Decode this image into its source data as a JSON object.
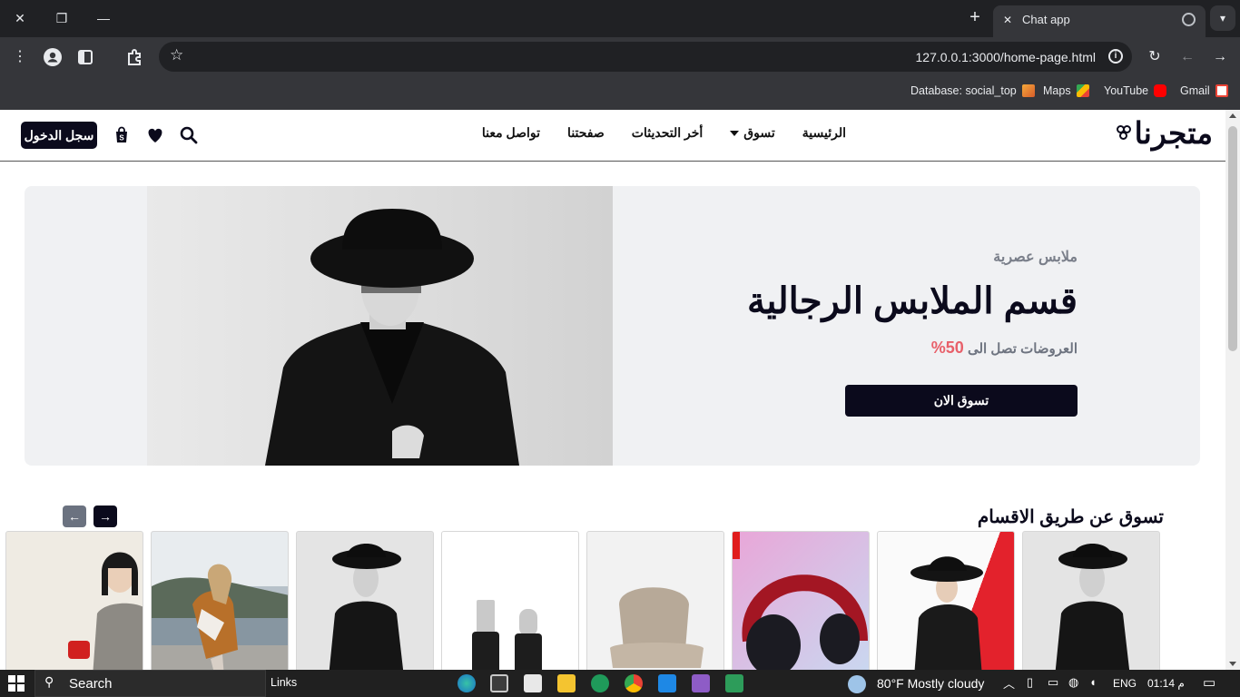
{
  "browser": {
    "tab_title": "Chat app",
    "url": "127.0.0.1:3000/home-page.html",
    "bookmarks": [
      {
        "label": "Database: social_top",
        "icon": "warning-stack-icon"
      },
      {
        "label": "Maps",
        "icon": "maps-icon"
      },
      {
        "label": "YouTube",
        "icon": "youtube-icon"
      },
      {
        "label": "Gmail",
        "icon": "gmail-icon"
      }
    ]
  },
  "site": {
    "logo": "متجرنا",
    "nav": [
      "الرئيسية",
      "تسوق",
      "أخر التحديثات",
      "صفحتنا",
      "تواصل معنا"
    ],
    "login_label": "سجل الدخول"
  },
  "hero": {
    "eyebrow": "ملابس عصرية",
    "title": "قسم الملابس الرجالية",
    "offer_prefix": "العروضات تصل الى",
    "offer_percent": "50%",
    "button": "تسوق الان"
  },
  "categories": {
    "title": "تسوق عن طريق الاقسام",
    "cards": [
      "woman-in-gray-coat",
      "woman-by-lake",
      "man-in-black-hat",
      "usb-cables",
      "beige-chair",
      "red-headphones",
      "woman-in-black-hat",
      "man-in-black-hat"
    ]
  },
  "taskbar": {
    "search": "Search",
    "links": "Links",
    "weather": "80°F  Mostly cloudy",
    "lang": "ENG",
    "time": "01:14 م"
  },
  "colors": {
    "brand_dark": "#0b0a1c",
    "accent_red": "#e8606a"
  }
}
